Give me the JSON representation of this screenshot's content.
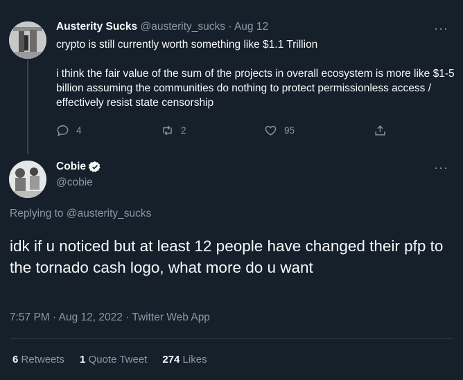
{
  "parent_tweet": {
    "display_name": "Austerity Sucks",
    "meta": "@austerity_sucks · Aug 12",
    "text": "crypto is still currently worth something like $1.1 Trillion\n\ni think the fair value of the sum of the projects in overall ecosystem is more like $1-5 billion assuming the communities do nothing to protect permissionless access / effectively resist state censorship",
    "reply_count": "4",
    "retweet_count": "2",
    "like_count": "95",
    "more": "···"
  },
  "main_tweet": {
    "display_name": "Cobie",
    "handle": "@cobie",
    "replying_to": "Replying to @austerity_sucks",
    "text": "idk if u noticed but at least 12 people have changed their pfp to the tornado cash logo, what more do u want",
    "timestamp": "7:57 PM · Aug 12, 2022 · Twitter Web App",
    "more": "···",
    "stats": {
      "retweets_count": "6",
      "retweets_label": "Retweets",
      "quotes_count": "1",
      "quotes_label": "Quote Tweet",
      "likes_count": "274",
      "likes_label": "Likes"
    }
  },
  "colors": {
    "background": "#15202b",
    "text": "#f7f9f9",
    "muted": "#8b98a5",
    "divider": "#38444d",
    "verified": "#f7f9f9"
  }
}
